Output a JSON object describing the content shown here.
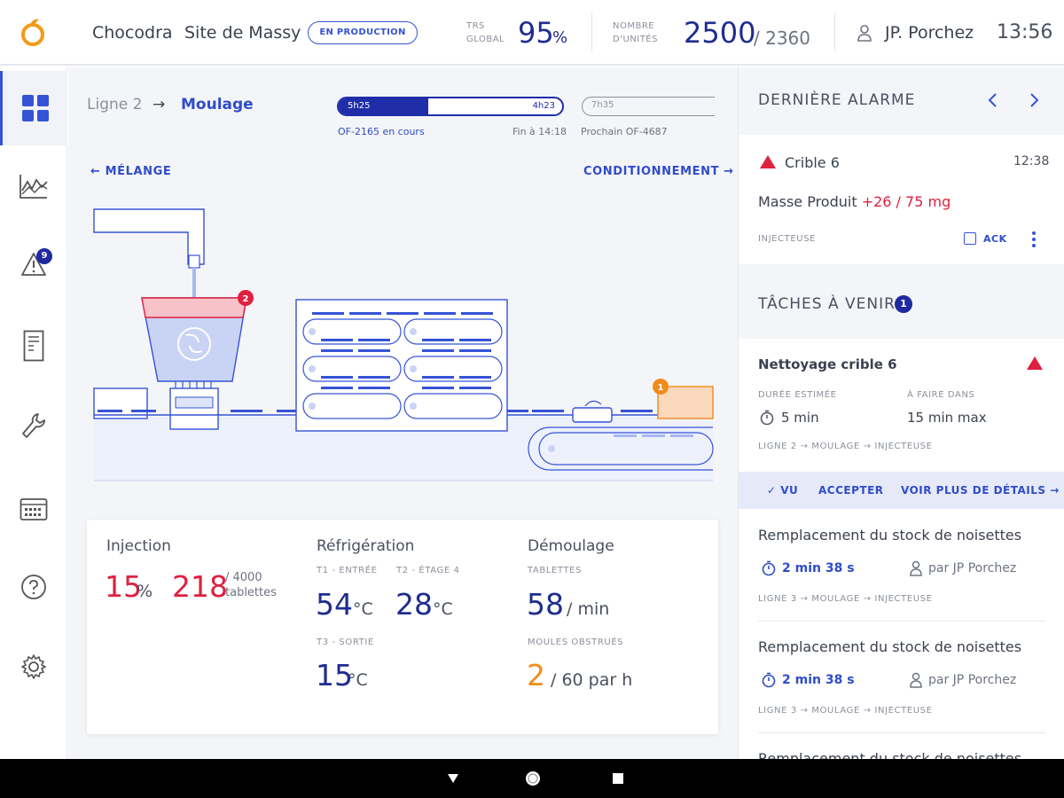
{
  "header": {
    "company": "Chocodra",
    "site": "Site de Massy",
    "status_badge": "EN PRODUCTION",
    "trs_label_1": "TRS",
    "trs_label_2": "GLOBAL",
    "trs_value": "95",
    "trs_unit": "%",
    "units_label_1": "NOMBRE",
    "units_label_2": "D'UNITÉS",
    "units_value": "2500",
    "units_total": "/ 2360",
    "user": "JP. Porchez",
    "time": "13:56"
  },
  "sidebar": {
    "items": [
      "dashboard-icon",
      "chart-icon",
      "alert-icon",
      "document-icon",
      "wrench-icon",
      "calendar-icon",
      "help-icon",
      "settings-icon"
    ],
    "alert_count": "9",
    "active": 0
  },
  "breadcrumb": {
    "line": "Ligne 2",
    "arrow": "→",
    "current": "Moulage"
  },
  "of_progress": {
    "start": "5h25",
    "end": "4h23",
    "fill_fraction": 0.4,
    "next_time": "7h35",
    "current_of": "OF-2165 en cours",
    "end_at": "Fin à 14:18",
    "next_of": "Prochain OF-4687"
  },
  "navigation": {
    "prev": "← MÉLANGE",
    "next": "CONDITIONNEMENT →"
  },
  "schema": {
    "badge_hopper": "2",
    "badge_output": "1"
  },
  "stats": {
    "injection": {
      "title": "Injection",
      "percent": "15",
      "percent_unit": "%",
      "count": "218",
      "count_total": "/ 4000",
      "count_unit": "tablettes"
    },
    "refrigeration": {
      "title": "Réfrigération",
      "t1_label": "T1 - ENTRÉE",
      "t1_value": "54",
      "t2_label": "T2 - ÉTAGE 4",
      "t2_value": "28",
      "t3_label": "T3 - SORTIE",
      "t3_value": "15",
      "unit": "°C"
    },
    "demoulage": {
      "title": "Démoulage",
      "tablets_label": "TABLETTES",
      "tablets_value": "58",
      "tablets_unit": "/ min",
      "moulds_label": "MOULES OBSTRUÉS",
      "moulds_value": "2",
      "moulds_unit": "/ 60 par h"
    }
  },
  "alarm": {
    "header": "DERNIÈRE ALARME",
    "name": "Crible 6",
    "time": "12:38",
    "message_prefix": "Masse Produit ",
    "message_value": "+26 / 75 mg",
    "source": "INJECTEUSE",
    "ack": "ACK"
  },
  "tasks": {
    "header": "TÂCHES À VENIR",
    "count": "1",
    "featured": {
      "title": "Nettoyage crible 6",
      "duration_label": "DURÉE ESTIMÉE",
      "duration_value": "5 min",
      "due_label": "À FAIRE DANS",
      "due_value": "15 min max",
      "path": "LIGNE 2 → MOULAGE → INJECTEUSE",
      "action_seen": "✓ VU",
      "action_accept": "ACCEPTER",
      "action_details": "VOIR PLUS DE DÉTAILS →"
    },
    "items": [
      {
        "title": "Remplacement du stock de noisettes",
        "timer": "2 min 38 s",
        "by": "par JP Porchez",
        "path": "LIGNE 3 → MOULAGE → INJECTEUSE"
      },
      {
        "title": "Remplacement du stock de noisettes",
        "timer": "2 min 38 s",
        "by": "par JP Porchez",
        "path": "LIGNE 3 → MOULAGE → INJECTEUSE"
      },
      {
        "title": "Remplacement du stock de noisettes"
      }
    ]
  },
  "colors": {
    "primary": "#2f4cc9",
    "dark_blue": "#1f2d8f",
    "alert_red": "#e0203f",
    "warning_orange": "#f28b1c"
  }
}
